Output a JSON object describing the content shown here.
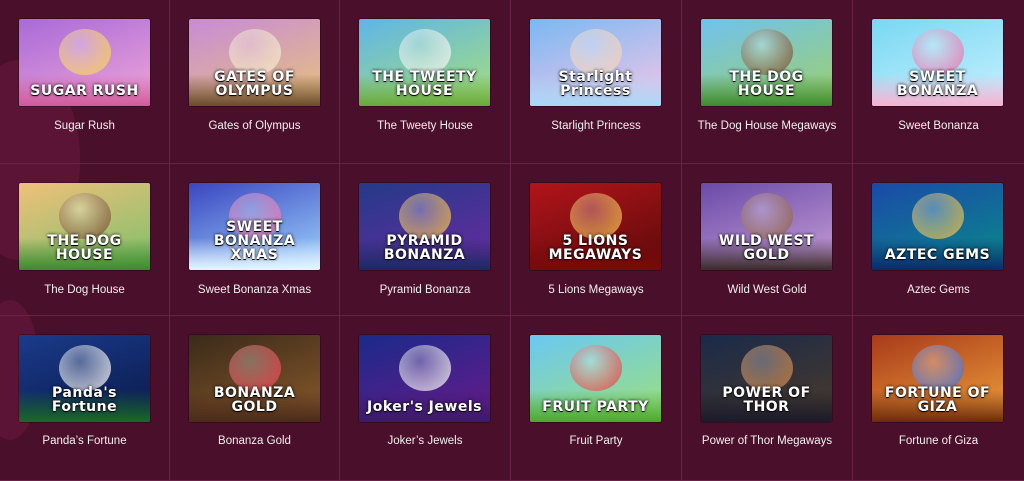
{
  "games": [
    {
      "title": "Sugar Rush",
      "logo": "SUGAR RUSH",
      "bg": [
        "#a86ad8",
        "#f1a6d8"
      ],
      "art": "#f7d046",
      "ground": "#d05a9a"
    },
    {
      "title": "Gates of Olympus",
      "logo": "GATES OF OLYMPUS",
      "bg": [
        "#c88ad8",
        "#e7c47a"
      ],
      "art": "#f3e6c8",
      "ground": "#6a4a2a"
    },
    {
      "title": "The Tweety House",
      "logo": "THE TWEETY HOUSE",
      "bg": [
        "#5fb5e8",
        "#a7e07a"
      ],
      "art": "#f1f1f1",
      "ground": "#6aa93a"
    },
    {
      "title": "Starlight Princess",
      "logo": "Starlight Princess",
      "bg": [
        "#7ab8f2",
        "#f3c6e8"
      ],
      "art": "#f3d0b0",
      "ground": "#a8d8f8"
    },
    {
      "title": "The Dog House Megaways",
      "logo": "THE DOG HOUSE",
      "bg": [
        "#6fc2f0",
        "#9ed06a"
      ],
      "art": "#7a4a2a",
      "ground": "#3d8a2e"
    },
    {
      "title": "Sweet Bonanza",
      "logo": "SWEET BONANZA",
      "bg": [
        "#78d8f2",
        "#c8f0ff"
      ],
      "art": "#f06aa6",
      "ground": "#f7b1d0"
    },
    {
      "title": "The Dog House",
      "logo": "THE DOG HOUSE",
      "bg": [
        "#f0c07a",
        "#7ac06a"
      ],
      "art": "#7a4a2a",
      "ground": "#3d8a2e"
    },
    {
      "title": "Sweet Bonanza Xmas",
      "logo": "SWEET BONANZA XMAS",
      "bg": [
        "#3a46c0",
        "#9fd6ff"
      ],
      "art": "#f06aa6",
      "ground": "#e8f4ff"
    },
    {
      "title": "Pyramid Bonanza",
      "logo": "PYRAMID BONANZA",
      "bg": [
        "#243a8a",
        "#6a2aa0"
      ],
      "art": "#f0b83a",
      "ground": "#1a2a60"
    },
    {
      "title": "5 Lions Megaways",
      "logo": "5 LIONS MEGAWAYS",
      "bg": [
        "#b2141a",
        "#5a0a0a"
      ],
      "art": "#f3b43a",
      "ground": "#7a0a0a"
    },
    {
      "title": "Wild West Gold",
      "logo": "WILD WEST GOLD",
      "bg": [
        "#6a4aa8",
        "#c8a0d8"
      ],
      "art": "#8a5a3a",
      "ground": "#3a2a2a"
    },
    {
      "title": "Aztec Gems",
      "logo": "AZTEC GEMS",
      "bg": [
        "#1a4aa8",
        "#0a8a8a"
      ],
      "art": "#e8b83a",
      "ground": "#0a2a6a"
    },
    {
      "title": "Panda’s Fortune",
      "logo": "Panda's Fortune",
      "bg": [
        "#1a3a8a",
        "#0a1a4a"
      ],
      "art": "#f4f4f4",
      "ground": "#1a6a2a"
    },
    {
      "title": "Bonanza Gold",
      "logo": "BONANZA GOLD",
      "bg": [
        "#3a2a1a",
        "#8a5a2a"
      ],
      "art": "#e83a4a",
      "ground": "#4a2a1a"
    },
    {
      "title": "Joker’s Jewels",
      "logo": "Joker's Jewels",
      "bg": [
        "#1a2a8a",
        "#6a1a8a"
      ],
      "art": "#f0f0f0",
      "ground": "#3a1a6a"
    },
    {
      "title": "Fruit Party",
      "logo": "FRUIT PARTY",
      "bg": [
        "#6ac8f2",
        "#9ee07a"
      ],
      "art": "#e83a3a",
      "ground": "#4aa82a"
    },
    {
      "title": "Power of Thor Megaways",
      "logo": "POWER OF THOR",
      "bg": [
        "#1a2a4a",
        "#4a3a2a"
      ],
      "art": "#c87a3a",
      "ground": "#1a1a2a"
    },
    {
      "title": "Fortune of Giza",
      "logo": "FORTUNE OF GIZA",
      "bg": [
        "#a83a1a",
        "#f0a03a"
      ],
      "art": "#3a6ad8",
      "ground": "#6a2a0a"
    }
  ]
}
